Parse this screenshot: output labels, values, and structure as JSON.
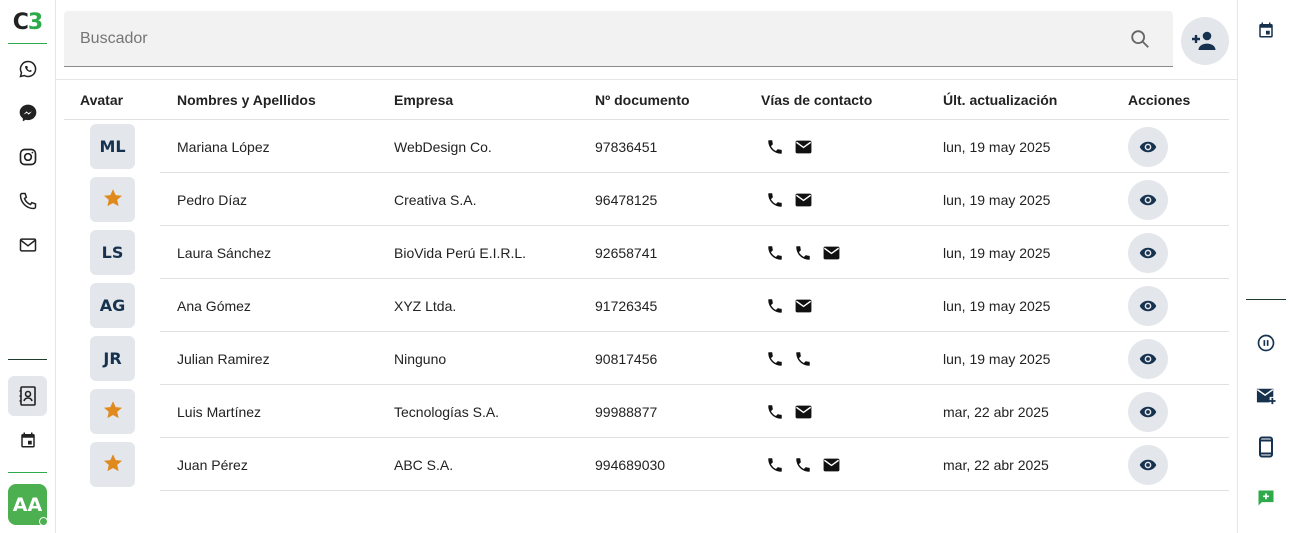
{
  "logo": {
    "c": "C",
    "three": "3"
  },
  "left_nav": [
    {
      "name": "whatsapp-icon"
    },
    {
      "name": "messenger-icon"
    },
    {
      "name": "instagram-icon"
    },
    {
      "name": "phone-icon"
    },
    {
      "name": "mail-icon"
    },
    {
      "name": "contacts-icon",
      "active": true
    },
    {
      "name": "calendar-icon"
    }
  ],
  "user": {
    "initials": "AA",
    "status_color": "#4caf50"
  },
  "search": {
    "placeholder": "Buscador",
    "value": ""
  },
  "table": {
    "headers": {
      "avatar": "Avatar",
      "name": "Nombres y Apellidos",
      "company": "Empresa",
      "document": "Nº documento",
      "contact": "Vías de contacto",
      "updated": "Últ. actualización",
      "actions": "Acciones"
    },
    "rows": [
      {
        "avatar": "ML",
        "star": false,
        "name": "Mariana López",
        "company": "WebDesign Co.",
        "document": "97836451",
        "contacts": [
          "phone",
          "mail"
        ],
        "updated": "lun, 19 may 2025"
      },
      {
        "avatar": "",
        "star": true,
        "name": "Pedro Díaz",
        "company": "Creativa S.A.",
        "document": "96478125",
        "contacts": [
          "phone",
          "mail"
        ],
        "updated": "lun, 19 may 2025"
      },
      {
        "avatar": "LS",
        "star": false,
        "name": "Laura Sánchez",
        "company": "BioVida Perú E.I.R.L.",
        "document": "92658741",
        "contacts": [
          "phone",
          "phone",
          "mail"
        ],
        "updated": "lun, 19 may 2025"
      },
      {
        "avatar": "AG",
        "star": false,
        "name": "Ana Gómez",
        "company": "XYZ Ltda.",
        "document": "91726345",
        "contacts": [
          "phone",
          "mail"
        ],
        "updated": "lun, 19 may 2025"
      },
      {
        "avatar": "JR",
        "star": false,
        "name": "Julian Ramirez",
        "company": "Ninguno",
        "document": "90817456",
        "contacts": [
          "phone",
          "phone"
        ],
        "updated": "lun, 19 may 2025"
      },
      {
        "avatar": "",
        "star": true,
        "name": "Luis Martínez",
        "company": "Tecnologías S.A.",
        "document": "99988877",
        "contacts": [
          "phone",
          "mail"
        ],
        "updated": "mar, 22 abr 2025"
      },
      {
        "avatar": "",
        "star": true,
        "name": "Juan Pérez",
        "company": "ABC S.A.",
        "document": "994689030",
        "contacts": [
          "phone",
          "phone",
          "mail"
        ],
        "updated": "mar, 22 abr 2025"
      }
    ]
  },
  "right_nav": [
    {
      "name": "calendar-icon"
    },
    {
      "name": "pause-circle-icon"
    },
    {
      "name": "mail-add-icon"
    },
    {
      "name": "mobile-icon"
    },
    {
      "name": "chat-add-icon"
    }
  ],
  "colors": {
    "accent": "#2eaa4a",
    "star": "#e08a1e",
    "navy": "#16324f",
    "button_bg": "#e3e6ea"
  }
}
